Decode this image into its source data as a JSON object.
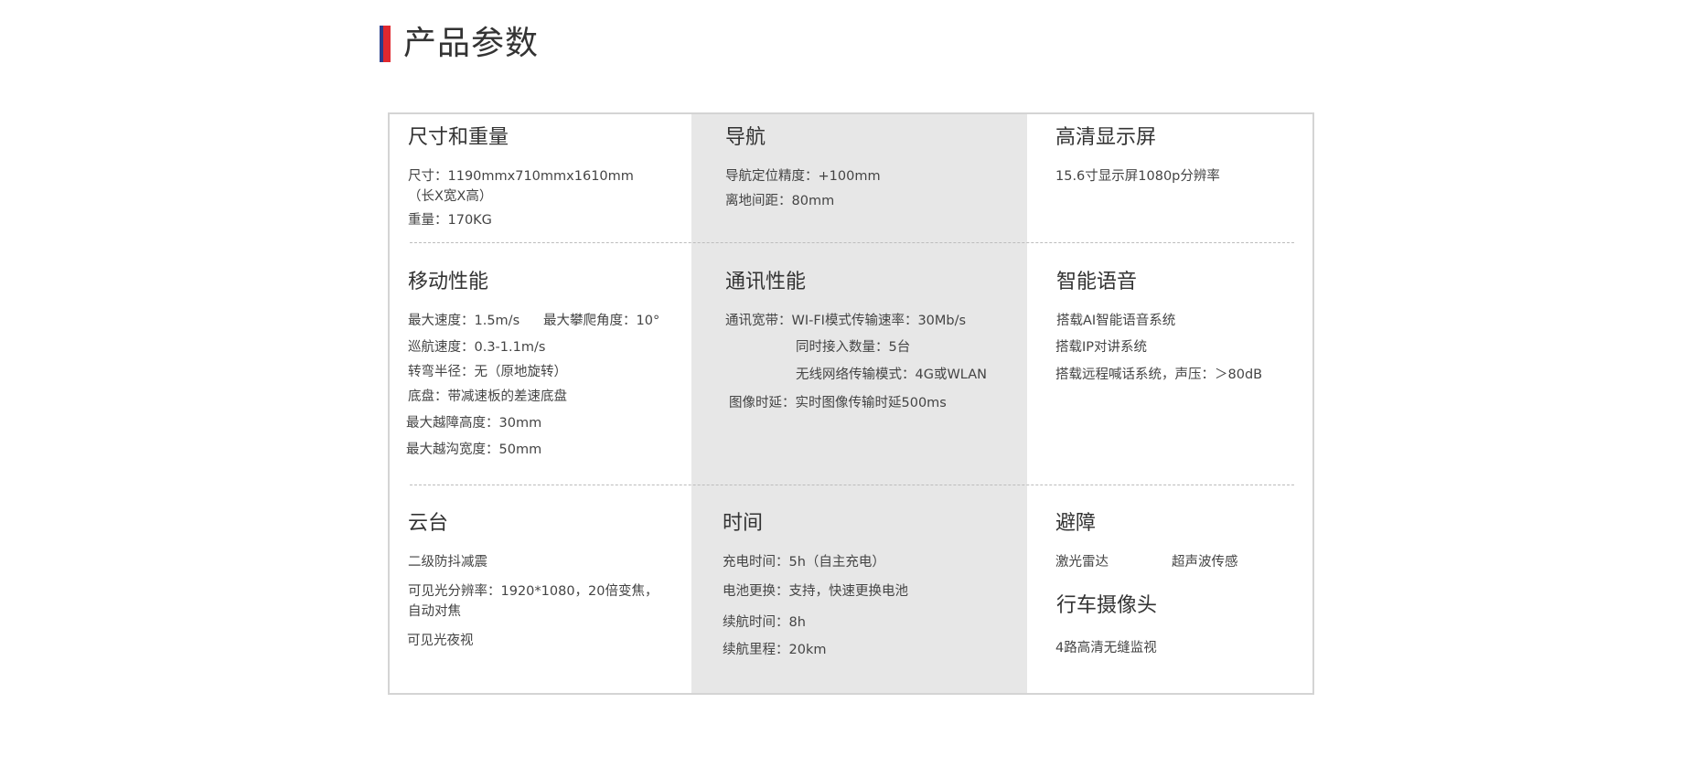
{
  "page_title": "产品参数",
  "sections": {
    "size_weight": {
      "heading": "尺寸和重量",
      "lines": [
        "尺寸：1190mmx710mmx1610mm",
        "（长X宽X高）",
        "重量：170KG"
      ]
    },
    "navigation": {
      "heading": "导航",
      "lines": [
        "导航定位精度：+100mm",
        "离地间距：80mm"
      ]
    },
    "hd_screen": {
      "heading": "高清显示屏",
      "lines": [
        "15.6寸显示屏1080p分辨率"
      ]
    },
    "mobility": {
      "heading": "移动性能",
      "lines": [
        "最大速度：1.5m/s",
        "最大攀爬角度：10°",
        "巡航速度：0.3-1.1m/s",
        "转弯半径：无（原地旋转）",
        "底盘：带减速板的差速底盘",
        "最大越障高度：30mm",
        "最大越沟宽度：50mm"
      ]
    },
    "communication": {
      "heading": "通讯性能",
      "lines": [
        "通讯宽带：WI-FI模式传输速率：30Mb/s",
        "同时接入数量：5台",
        "无线网络传输模式：4G或WLAN",
        "图像时延：实时图像传输时延500ms"
      ]
    },
    "voice": {
      "heading": "智能语音",
      "lines": [
        "搭载AI智能语音系统",
        "搭载IP对讲系统",
        "搭载远程喊话系统，声压：＞80dB"
      ]
    },
    "gimbal": {
      "heading": "云台",
      "lines": [
        "二级防抖减震",
        "可见光分辨率：1920*1080，20倍变焦，",
        "自动对焦",
        "可见光夜视"
      ]
    },
    "time": {
      "heading": "时间",
      "lines": [
        "充电时间：5h（自主充电）",
        "电池更换：支持，快速更换电池",
        "续航时间：8h",
        "续航里程：20km"
      ]
    },
    "obstacle": {
      "heading": "避障",
      "lines": [
        "激光雷达",
        "超声波传感"
      ]
    },
    "dashcam": {
      "heading": "行车摄像头",
      "lines": [
        "4路高清无缝监视"
      ]
    }
  }
}
